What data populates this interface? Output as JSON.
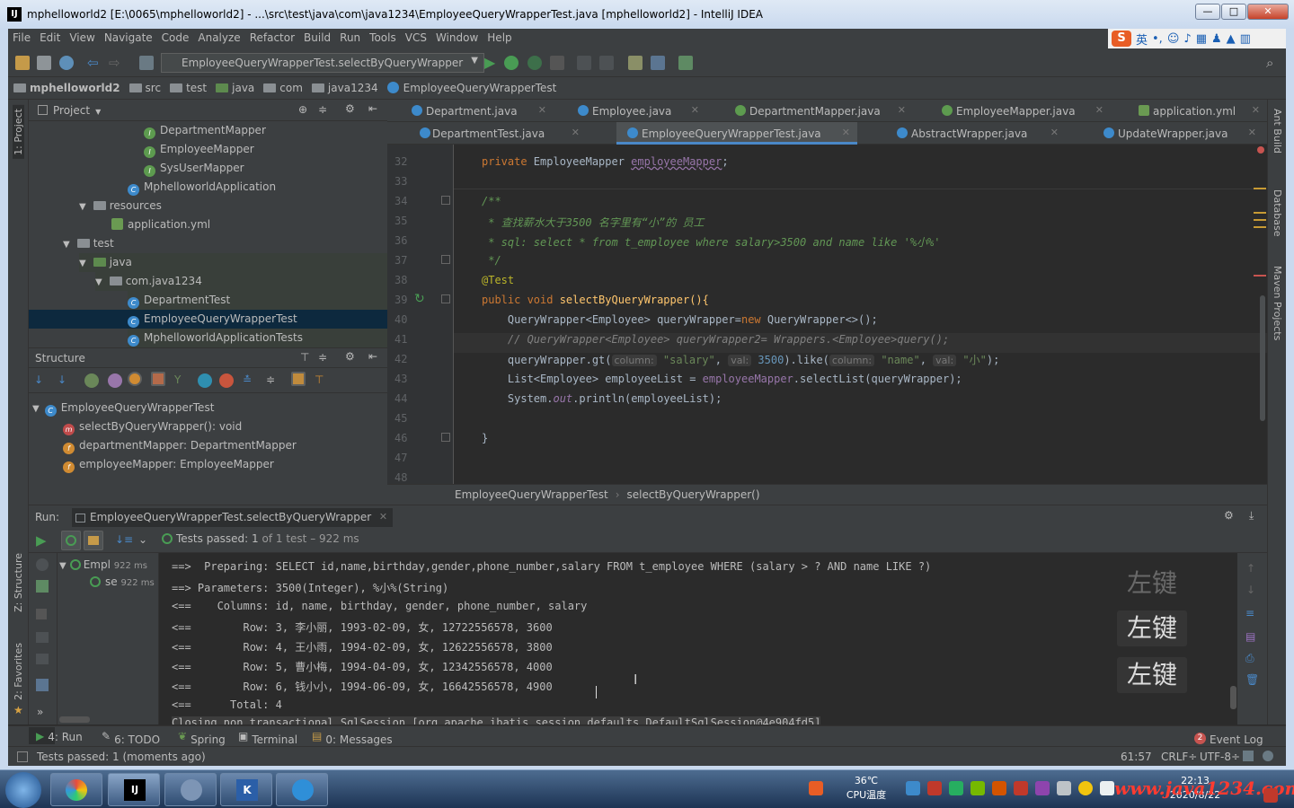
{
  "window": {
    "title": "mphelloworld2 [E:\\0065\\mphelloworld2] - ...\\src\\test\\java\\com\\java1234\\EmployeeQueryWrapperTest.java [mphelloworld2] - IntelliJ IDEA",
    "controls": [
      "—",
      "□",
      "✕"
    ]
  },
  "menu": [
    "File",
    "Edit",
    "View",
    "Navigate",
    "Code",
    "Analyze",
    "Refactor",
    "Build",
    "Run",
    "Tools",
    "VCS",
    "Window",
    "Help"
  ],
  "ime": {
    "mode": "英"
  },
  "toolbar": {
    "run_config": "EmployeeQueryWrapperTest.selectByQueryWrapper"
  },
  "breadcrumb": [
    "mphelloworld2",
    "src",
    "test",
    "java",
    "com",
    "java1234",
    "EmployeeQueryWrapperTest"
  ],
  "left_strip": {
    "project": "1: Project",
    "structure": "Z: Structure",
    "favorites": "2: Favorites"
  },
  "right_strip": {
    "ant": "Ant Build",
    "database": "Database",
    "maven": "Maven Projects"
  },
  "project": {
    "title": "Project",
    "items": [
      {
        "label": "DepartmentMapper",
        "kind": "interface"
      },
      {
        "label": "EmployeeMapper",
        "kind": "interface"
      },
      {
        "label": "SysUserMapper",
        "kind": "interface"
      },
      {
        "label": "MphelloworldApplication",
        "kind": "class"
      },
      {
        "label": "resources",
        "kind": "folder"
      },
      {
        "label": "application.yml",
        "kind": "yml"
      },
      {
        "label": "test",
        "kind": "folder"
      },
      {
        "label": "java",
        "kind": "folder"
      },
      {
        "label": "com.java1234",
        "kind": "package"
      },
      {
        "label": "DepartmentTest",
        "kind": "class"
      },
      {
        "label": "EmployeeQueryWrapperTest",
        "kind": "class"
      },
      {
        "label": "MphelloworldApplicationTests",
        "kind": "class"
      }
    ]
  },
  "structure": {
    "title": "Structure",
    "items": [
      {
        "label": "EmployeeQueryWrapperTest"
      },
      {
        "label": "selectByQueryWrapper(): void"
      },
      {
        "label": "departmentMapper: DepartmentMapper"
      },
      {
        "label": "employeeMapper: EmployeeMapper"
      }
    ]
  },
  "tabs_row1": [
    "Department.java",
    "Employee.java",
    "DepartmentMapper.java",
    "EmployeeMapper.java",
    "application.yml"
  ],
  "tabs_row2": [
    "DepartmentTest.java",
    "EmployeeQueryWrapperTest.java",
    "AbstractWrapper.java",
    "UpdateWrapper.java"
  ],
  "code": {
    "line_numbers": [
      "32",
      "33",
      "34",
      "35",
      "36",
      "37",
      "38",
      "39",
      "40",
      "41",
      "42",
      "43",
      "44",
      "45",
      "46",
      "47",
      "48"
    ],
    "l32_kw": "private ",
    "l32_type": "EmployeeMapper ",
    "l32_field": "employeeMapper",
    "l32_end": ";",
    "l34": "/**",
    "l35": " * 查找薪水大于3500 名字里有“小”的 员工",
    "l36": " * sql: select * from t_employee where salary>3500 and name like '%小%'",
    "l37": " */",
    "l38": "@Test",
    "l39_kw": "public void ",
    "l39_rest": "selectByQueryWrapper(){",
    "l40_a": "    QueryWrapper<Employee> queryWrapper=",
    "l40_kw": "new ",
    "l40_b": "QueryWrapper<>();",
    "l41": "    // QueryWrapper<Employee> queryWrapper2= Wrappers.<Employee>query();",
    "l42_a": "    queryWrapper.gt(",
    "l42_h1": "column:",
    "l42_s1": " \"salary\"",
    "l42_c1": ", ",
    "l42_h2": "val:",
    "l42_n": " 3500",
    "l42_b": ").like(",
    "l42_h3": "column:",
    "l42_s2": " \"name\"",
    "l42_c2": ", ",
    "l42_h4": "val:",
    "l42_s3": " \"小\"",
    "l42_end": ");",
    "l43_a": "    List<Employee> employeeList = ",
    "l43_field": "employeeMapper",
    "l43_b": ".selectList(queryWrapper);",
    "l44_a": "    System.",
    "l44_field": "out",
    "l44_b": ".println(employeeList);",
    "l46": "}"
  },
  "editor_breadcrumb": [
    "EmployeeQueryWrapperTest",
    "selectByQueryWrapper()"
  ],
  "run": {
    "label": "Run:",
    "tab": "EmployeeQueryWrapperTest.selectByQueryWrapper",
    "status_pre": "Tests passed:",
    "status_count": "1",
    "status_post": "of 1 test – 922 ms",
    "tree": [
      {
        "label": "Empl",
        "time": "922 ms"
      },
      {
        "label": "se",
        "time": "922 ms"
      }
    ],
    "console": [
      "==>  Preparing: SELECT id,name,birthday,gender,phone_number,salary FROM t_employee WHERE (salary > ? AND name LIKE ?)",
      "==> Parameters: 3500(Integer), %小%(String)",
      "<==    Columns: id, name, birthday, gender, phone_number, salary",
      "<==        Row: 3, 李小丽, 1993-02-09, 女, 12722556578, 3600",
      "<==        Row: 4, 王小雨, 1994-02-09, 女, 12622556578, 3800",
      "<==        Row: 5, 曹小梅, 1994-04-09, 女, 12342556578, 4000",
      "<==        Row: 6, 钱小小, 1994-06-09, 女, 16642556578, 4900",
      "<==      Total: 4",
      "Closing non transactional SqlSession [org.apache.ibatis.session.defaults.DefaultSqlSession@4e904fd5]"
    ],
    "overlay_keys": [
      "左键",
      "左键",
      "左键"
    ]
  },
  "tool_windows": [
    "4: Run",
    "6: TODO",
    "Spring",
    "Terminal",
    "0: Messages"
  ],
  "event_log": {
    "label": "Event Log",
    "count": "2"
  },
  "status": {
    "message": "Tests passed: 1 (moments ago)",
    "position": "61:57",
    "line_sep": "CRLF÷",
    "encoding": "UTF-8÷"
  },
  "taskbar": {
    "temp": "36℃",
    "cpu": "CPU温度",
    "time": "22:13",
    "date": "2020/8/22",
    "watermark": "www.java1234.com"
  },
  "colors": {
    "accent": "#4a88c7",
    "keyword": "#cc7832",
    "comment": "#629755",
    "string": "#6a8759",
    "number": "#6897bb",
    "field": "#9876aa",
    "pass": "#499c54"
  }
}
